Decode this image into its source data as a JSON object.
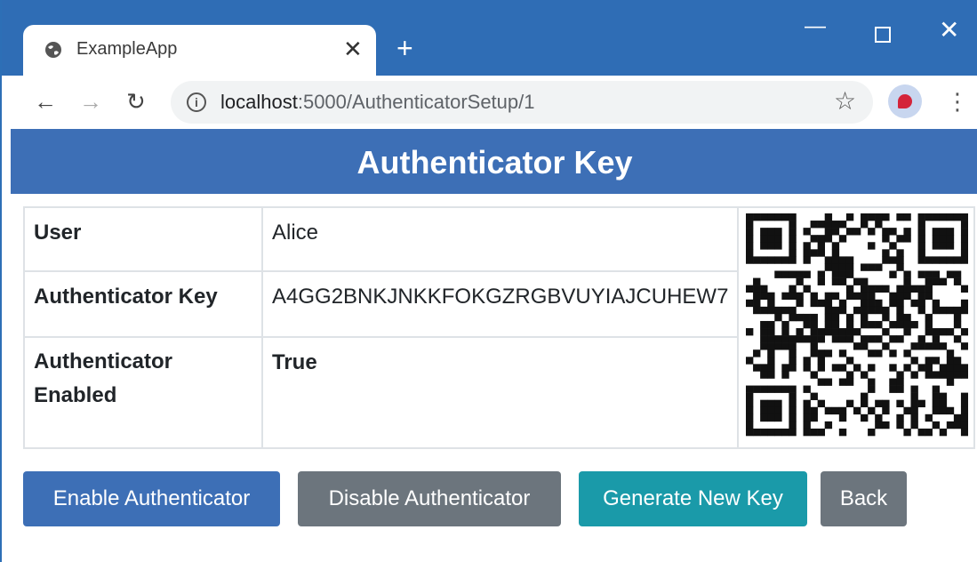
{
  "browser": {
    "tab_title": "ExampleApp",
    "tab_close": "✕",
    "new_tab": "+",
    "url_host": "localhost",
    "url_path": ":5000/AuthenticatorSetup/1"
  },
  "page": {
    "title": "Authenticator Key",
    "rows": [
      {
        "label": "User",
        "value": "Alice"
      },
      {
        "label": "Authenticator Key",
        "value": "A4GG2BNKJNKKFOKGZRGBVUYIAJCUHEW7"
      },
      {
        "label": "Authenticator Enabled",
        "value": "True"
      }
    ]
  },
  "buttons": {
    "enable": "Enable Authenticator",
    "disable": "Disable Authenticator",
    "generate": "Generate New Key",
    "back": "Back"
  },
  "colors": {
    "chrome_blue": "#2f6db5",
    "header_blue": "#3d6fb6",
    "secondary": "#6c757d",
    "info": "#1a9aa9",
    "success": "#28a745"
  }
}
